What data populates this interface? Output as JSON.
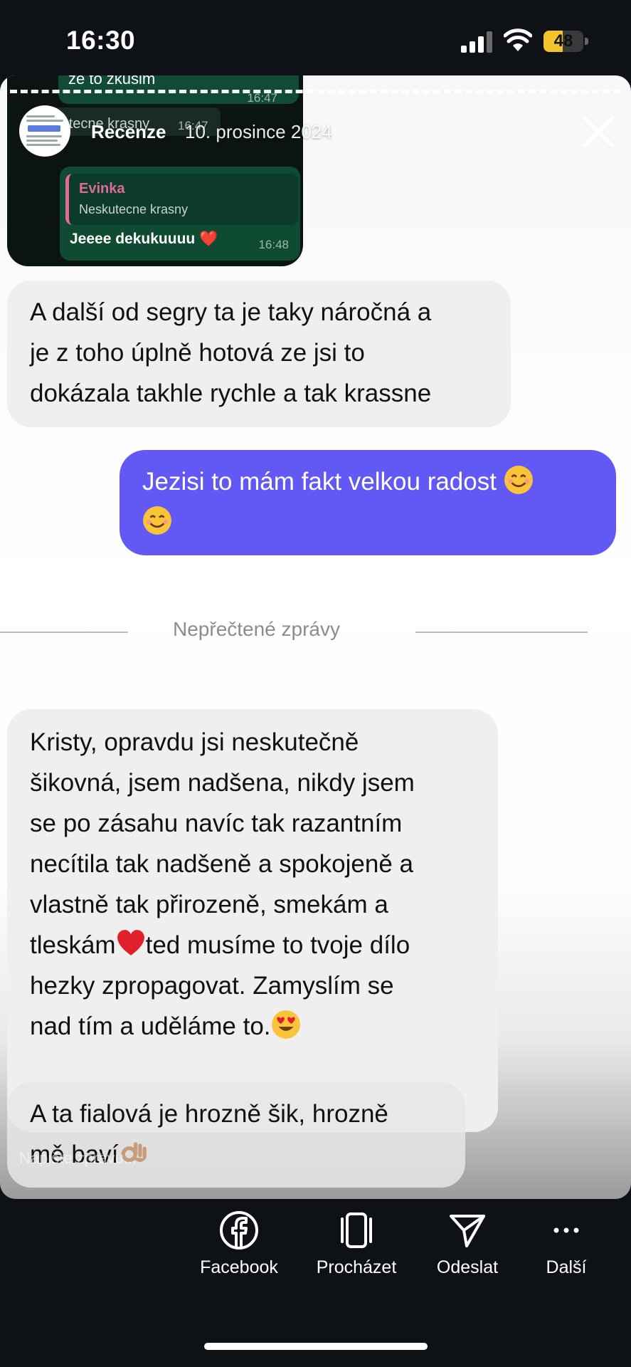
{
  "status_bar": {
    "time": "16:30",
    "battery": "48",
    "battery_level": 0.48
  },
  "story": {
    "name": "Recenze",
    "date": "10. prosince 2024",
    "reply_placeholder": "Napište zprávu..."
  },
  "whatsapp_screenshot": {
    "top_message": "ze to zkusim",
    "top_time": "16:47",
    "quoted_strip_text": "Neskutecne krasny",
    "quoted_strip_time": "16:47",
    "quote_name": "Evinka",
    "quote_text": "Neskutecne krasny",
    "message": "Jeeee dekukuuuu ❤️",
    "time": "16:48"
  },
  "messages": {
    "m1": {
      "line1": "A další od segry ta je taky náročná a",
      "line2": "je z toho úplně hotová ze jsi to",
      "line3": "dokázala takhle rychle a tak krassne"
    },
    "m2": {
      "line1": "Jezisi to mám fakt velkou radost"
    },
    "divider": "Nepřečtené zprávy",
    "m3": {
      "line1": "Kristy, opravdu jsi neskutečně",
      "line2": "šikovná, jsem nadšena, nikdy jsem",
      "line3": "se po zásahu navíc tak razantním",
      "line4": "necítila tak nadšeně a spokojeně a",
      "line5": "vlastně tak přirozeně, smekám a",
      "line6a": "tleskám",
      "line6b": "ted musíme to tvoje dílo",
      "line7": "hezky zpropagovat. Zamyslím se",
      "line8": "nad tím a uděláme to."
    },
    "m4": {
      "line1": "A ta fialová je hrozně šik, hrozně",
      "line2": "mě baví"
    }
  },
  "actions": {
    "facebook": "Facebook",
    "browse": "Procházet",
    "send": "Odeslat",
    "more": "Další"
  },
  "colors": {
    "outgoing_bubble": "#6259f5",
    "incoming_bubble": "#efeff0",
    "background": "#0e1116"
  }
}
